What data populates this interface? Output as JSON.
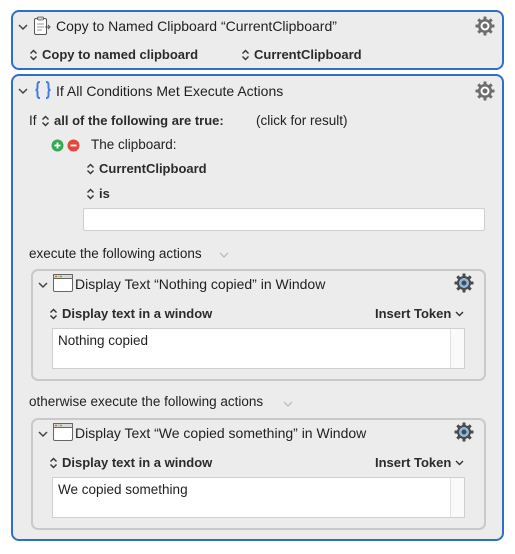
{
  "action1": {
    "title": "Copy to Named Clipboard “CurrentClipboard”",
    "popup_action": "Copy to named clipboard",
    "popup_clipboard": "CurrentClipboard"
  },
  "action2": {
    "title": "If All Conditions Met Execute Actions",
    "if_label": "If",
    "condition_mode": "all of the following are true:",
    "click_for_result": "(click for result)",
    "condition_type": "The clipboard:",
    "clipboard_name": "CurrentClipboard",
    "operator": "is",
    "value": "",
    "execute_label": "execute the following actions",
    "otherwise_label": "otherwise execute the following actions",
    "then_action": {
      "title": "Display Text “Nothing copied” in Window",
      "popup": "Display text in a window",
      "insert_token": "Insert Token",
      "text": "Nothing copied"
    },
    "else_action": {
      "title": "Display Text “We copied something” in Window",
      "popup": "Display text in a window",
      "insert_token": "Insert Token",
      "text": "We copied something"
    }
  },
  "colors": {
    "selected_border": "#2f6fc9",
    "add_button": "#34a853",
    "remove_button": "#e0483e"
  },
  "icons": [
    "chevron-down-icon",
    "clipboard-icon",
    "gear-icon",
    "curly-braces-icon",
    "up-down-arrows-icon",
    "add-icon",
    "remove-icon",
    "window-icon"
  ]
}
